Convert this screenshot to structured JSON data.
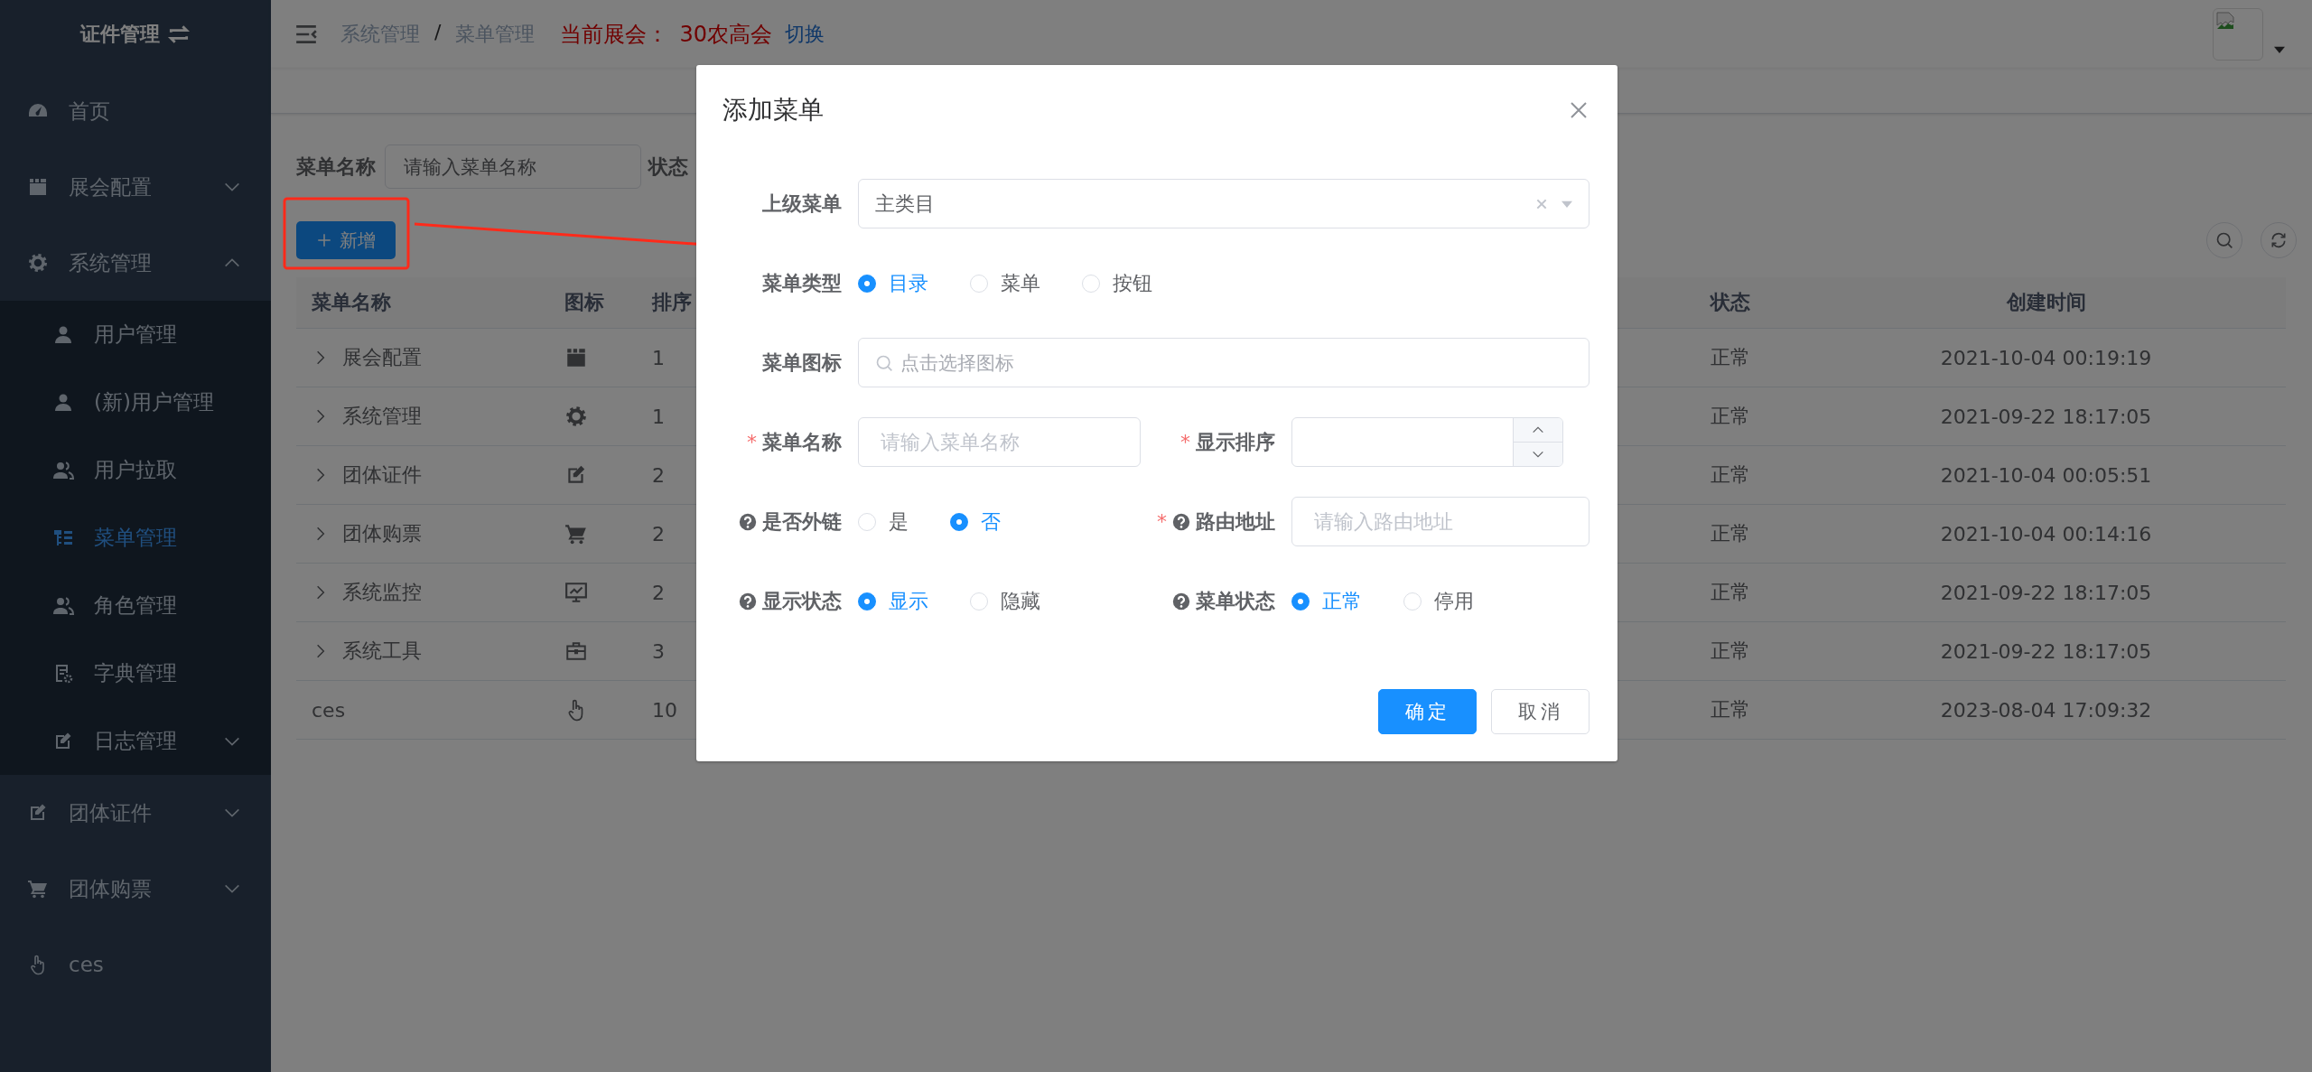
{
  "sidebar": {
    "title": "证件管理",
    "items": [
      {
        "label": "首页",
        "kind": "link",
        "selected": false
      },
      {
        "label": "展会配置",
        "kind": "submenu",
        "expanded": false,
        "selected": false
      },
      {
        "label": "系统管理",
        "kind": "submenu",
        "expanded": true,
        "selected": false,
        "children": [
          {
            "label": "用户管理",
            "kind": "link",
            "selected": false
          },
          {
            "label": "(新)用户管理",
            "kind": "link",
            "selected": false
          },
          {
            "label": "用户拉取",
            "kind": "link",
            "selected": false
          },
          {
            "label": "菜单管理",
            "kind": "link",
            "selected": true
          },
          {
            "label": "角色管理",
            "kind": "link",
            "selected": false
          },
          {
            "label": "字典管理",
            "kind": "link",
            "selected": false
          },
          {
            "label": "日志管理",
            "kind": "submenu",
            "expanded": false,
            "selected": false
          }
        ]
      },
      {
        "label": "团体证件",
        "kind": "submenu",
        "expanded": false,
        "selected": false
      },
      {
        "label": "团体购票",
        "kind": "submenu",
        "expanded": false,
        "selected": false
      },
      {
        "label": "ces",
        "kind": "link",
        "selected": false
      }
    ]
  },
  "header": {
    "breadcrumb": [
      "系统管理",
      "菜单管理"
    ],
    "breadcrumb_separator": "/",
    "exhibition_label": "当前展会：",
    "exhibition": "30农高会",
    "switch_link": "切换"
  },
  "search": {
    "fields": [
      {
        "label": "菜单名称",
        "placeholder": "请输入菜单名称"
      },
      {
        "label": "状态"
      }
    ]
  },
  "toolbar": {
    "add_button": "新增"
  },
  "table": {
    "columns": [
      "菜单名称",
      "图标",
      "排序",
      "状态",
      "创建时间"
    ],
    "rows": [
      {
        "name": "展会配置",
        "kind": "folder",
        "order": "1",
        "status": "正常",
        "created": "2021-10-04 00:19:19"
      },
      {
        "name": "系统管理",
        "kind": "folder",
        "order": "1",
        "status": "正常",
        "created": "2021-09-22 18:17:05"
      },
      {
        "name": "团体证件",
        "kind": "folder",
        "order": "2",
        "status": "正常",
        "created": "2021-10-04 00:05:51"
      },
      {
        "name": "团体购票",
        "kind": "folder",
        "order": "2",
        "status": "正常",
        "created": "2021-10-04 00:14:16"
      },
      {
        "name": "系统监控",
        "kind": "folder",
        "order": "2",
        "status": "正常",
        "created": "2021-09-22 18:17:05"
      },
      {
        "name": "系统工具",
        "kind": "folder",
        "order": "3",
        "status": "正常",
        "created": "2021-09-22 18:17:05"
      },
      {
        "name": "ces",
        "kind": "leaf",
        "order": "10",
        "status": "正常",
        "created": "2023-08-04 17:09:32"
      }
    ]
  },
  "dialog": {
    "title": "添加菜单",
    "rows": [
      {
        "fields": [
          {
            "label": "上级菜单",
            "help": false,
            "kind": "select",
            "value": "主类目"
          }
        ]
      },
      {
        "fields": [
          {
            "label": "菜单类型",
            "help": false,
            "kind": "radio",
            "options": [
              {
                "label": "目录",
                "selected": true
              },
              {
                "label": "菜单",
                "selected": false
              },
              {
                "label": "按钮",
                "selected": false
              }
            ]
          }
        ]
      },
      {
        "fields": [
          {
            "label": "菜单图标",
            "help": false,
            "kind": "icon-picker",
            "placeholder": "点击选择图标"
          }
        ]
      },
      {
        "fields": [
          {
            "label": "菜单名称",
            "required_mark": "*",
            "help": false,
            "kind": "text",
            "placeholder": "请输入菜单名称"
          },
          {
            "label": "显示排序",
            "required_mark": "*",
            "help": false,
            "kind": "number"
          }
        ]
      },
      {
        "fields": [
          {
            "label": "是否外链",
            "help": true,
            "kind": "radio",
            "options": [
              {
                "label": "是",
                "selected": false
              },
              {
                "label": "否",
                "selected": true
              }
            ]
          },
          {
            "label": "路由地址",
            "required_mark": "*",
            "help": true,
            "kind": "text",
            "placeholder": "请输入路由地址"
          }
        ]
      },
      {
        "fields": [
          {
            "label": "显示状态",
            "help": true,
            "kind": "radio",
            "options": [
              {
                "label": "显示",
                "selected": true
              },
              {
                "label": "隐藏",
                "selected": false
              }
            ]
          },
          {
            "label": "菜单状态",
            "help": true,
            "kind": "radio",
            "options": [
              {
                "label": "正常",
                "selected": true
              },
              {
                "label": "停用",
                "selected": false
              }
            ]
          }
        ]
      }
    ],
    "buttons": [
      {
        "label": "确定",
        "kind": "primary"
      },
      {
        "label": "取消",
        "kind": "default"
      }
    ]
  },
  "annotation": {
    "kind": "box-arrow"
  }
}
